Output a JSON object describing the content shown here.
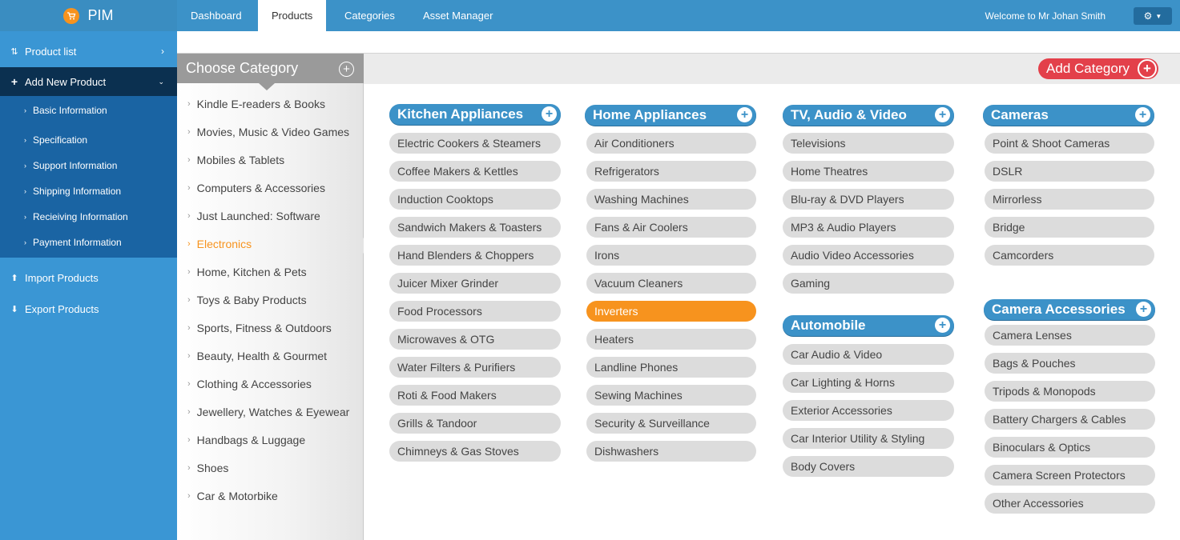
{
  "app": {
    "name": "PIM"
  },
  "nav": {
    "tabs": [
      "Dashboard",
      "Products",
      "Categories",
      "Asset Manager"
    ],
    "active": "Products",
    "welcome": "Welcome to Mr Johan Smith"
  },
  "sidebar": {
    "product_list": "Product list",
    "add_new_product": "Add New Product",
    "sub_items": [
      "Basic Information",
      "Specification",
      "Support Information",
      "Shipping Information",
      "Recieiving Information",
      "Payment Information"
    ],
    "import_products": "Import Products",
    "export_products": "Export Products"
  },
  "choose_category": {
    "title": "Choose Category",
    "items": [
      "Kindle E-readers & Books",
      "Movies, Music & Video Games",
      "Mobiles & Tablets",
      "Computers & Accessories",
      "Just Launched: Software",
      "Electronics",
      "Home, Kitchen & Pets",
      "Toys & Baby Products",
      "Sports, Fitness & Outdoors",
      "Beauty, Health & Gourmet",
      "Clothing & Accessories",
      "Jewellery, Watches & Eyewear",
      "Handbags & Luggage",
      "Shoes",
      "Car & Motorbike"
    ],
    "active": "Electronics"
  },
  "main": {
    "add_category": "Add Category",
    "groups": [
      {
        "title": "Kitchen Appliances",
        "items": [
          "Electric Cookers & Steamers",
          "Coffee Makers & Kettles",
          "Induction Cooktops",
          "Sandwich Makers & Toasters",
          "Hand Blenders & Choppers",
          "Juicer Mixer Grinder",
          "Food Processors",
          "Microwaves & OTG",
          "Water Filters & Purifiers",
          "Roti & Food Makers",
          "Grills & Tandoor",
          "Chimneys & Gas Stoves"
        ]
      },
      {
        "title": "Home Appliances",
        "items": [
          "Air Conditioners",
          "Refrigerators",
          "Washing Machines",
          "Fans & Air Coolers",
          "Irons",
          "Vacuum Cleaners",
          "Inverters",
          "Heaters",
          "Landline Phones",
          "Sewing Machines",
          "Security & Surveillance",
          "Dishwashers"
        ],
        "selected": "Inverters"
      },
      {
        "title": "TV, Audio & Video",
        "items": [
          "Televisions",
          "Home Theatres",
          "Blu-ray & DVD Players",
          "MP3 & Audio Players",
          "Audio Video Accessories",
          "Gaming"
        ]
      },
      {
        "title": "Automobile",
        "items": [
          "Car Audio & Video",
          "Car Lighting & Horns",
          "Exterior Accessories",
          "Car Interior Utility & Styling",
          "Body Covers"
        ]
      },
      {
        "title": "Cameras",
        "items": [
          "Point & Shoot Cameras",
          "DSLR",
          "Mirrorless",
          "Bridge",
          "Camcorders"
        ]
      },
      {
        "title": "Camera Accessories",
        "items": [
          "Camera Lenses",
          "Bags & Pouches",
          "Tripods & Monopods",
          "Battery Chargers & Cables",
          "Binoculars & Optics",
          "Camera Screen Protectors",
          "Other Accessories"
        ]
      }
    ]
  },
  "colors": {
    "accent": "#3c92c8",
    "selected": "#f7931e",
    "add": "#e3404a"
  }
}
